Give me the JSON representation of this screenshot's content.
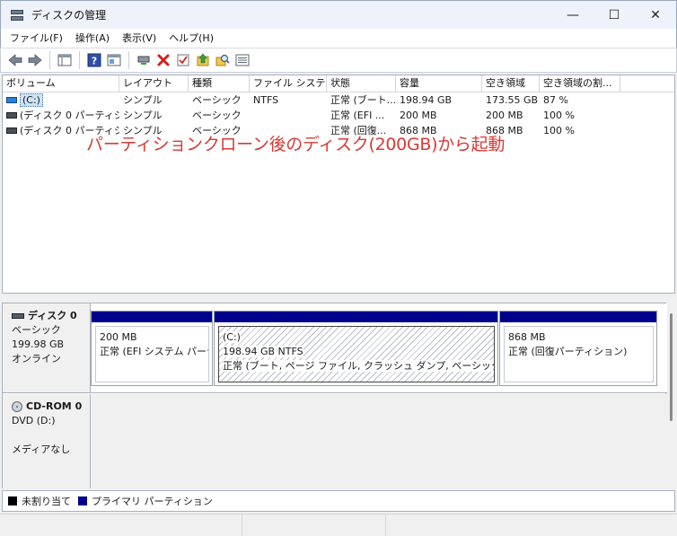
{
  "window": {
    "title": "ディスクの管理",
    "minimize": "—",
    "maximize": "☐",
    "close": "✕"
  },
  "menu": [
    "ファイル(F)",
    "操作(A)",
    "表示(V)",
    "ヘルプ(H)"
  ],
  "volume_list": {
    "columns": [
      "ボリューム",
      "レイアウト",
      "種類",
      "ファイル システム",
      "状態",
      "容量",
      "空き領域",
      "空き領域の割..."
    ],
    "rows": [
      {
        "name": "(C:)",
        "layout": "シンプル",
        "type": "ベーシック",
        "fs": "NTFS",
        "status": "正常 (ブート...",
        "capacity": "198.94 GB",
        "free": "173.55 GB",
        "free_pct": "87 %"
      },
      {
        "name": "(ディスク 0 パーティシ...",
        "layout": "シンプル",
        "type": "ベーシック",
        "fs": "",
        "status": "正常 (EFI ...",
        "capacity": "200 MB",
        "free": "200 MB",
        "free_pct": "100 %"
      },
      {
        "name": "(ディスク 0 パーティシ...",
        "layout": "シンプル",
        "type": "ベーシック",
        "fs": "",
        "status": "正常 (回復...",
        "capacity": "868 MB",
        "free": "868 MB",
        "free_pct": "100 %"
      }
    ]
  },
  "annotation": "パーティションクローン後のディスク(200GB)から起動",
  "disks": [
    {
      "name": "ディスク 0",
      "kind": "ベーシック",
      "size": "199.98 GB",
      "state": "オンライン",
      "partitions": [
        {
          "line1": "200 MB",
          "line2": "正常 (EFI システム パーティ"
        },
        {
          "label": "(C:)",
          "line1": "198.94 GB NTFS",
          "line2": "正常 (ブート, ページ ファイル, クラッシュ ダンプ, ベーシック データ パ"
        },
        {
          "line1": "868 MB",
          "line2": "正常 (回復パーティション)"
        }
      ]
    },
    {
      "name": "CD-ROM 0",
      "kind": "DVD (D:)",
      "size": "",
      "state": "メディアなし"
    }
  ],
  "legend": [
    {
      "label": "未割り当て",
      "color": "#000000"
    },
    {
      "label": "プライマリ パーティション",
      "color": "#00008b"
    }
  ],
  "colors": {
    "accent": "#00008b",
    "annotation": "#d63a35"
  },
  "icons": [
    "back-arrow-icon",
    "forward-arrow-icon",
    "console-tree-icon",
    "help-icon",
    "details-icon",
    "connect-icon",
    "delete-icon",
    "properties-icon",
    "up-arrow-icon",
    "search-icon",
    "list-icon"
  ]
}
